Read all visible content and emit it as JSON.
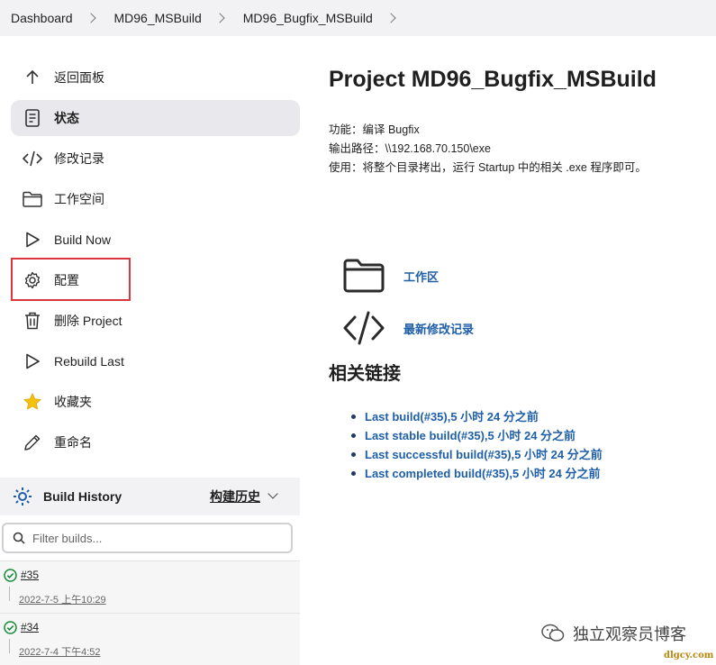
{
  "breadcrumb": [
    "Dashboard",
    "MD96_MSBuild",
    "MD96_Bugfix_MSBuild"
  ],
  "sidebar": {
    "items": [
      {
        "label": "返回面板",
        "icon": "arrow-up-icon"
      },
      {
        "label": "状态",
        "icon": "document-icon"
      },
      {
        "label": "修改记录",
        "icon": "code-icon"
      },
      {
        "label": "工作空间",
        "icon": "folder-icon"
      },
      {
        "label": "Build Now",
        "icon": "play-icon"
      },
      {
        "label": "配置",
        "icon": "gear-icon"
      },
      {
        "label": "删除 Project",
        "icon": "trash-icon"
      },
      {
        "label": "Rebuild Last",
        "icon": "play-icon"
      },
      {
        "label": "收藏夹",
        "icon": "star-icon"
      },
      {
        "label": "重命名",
        "icon": "pencil-icon"
      }
    ]
  },
  "build_history": {
    "title": "Build History",
    "trend": "构建历史",
    "filter_placeholder": "Filter builds...",
    "builds": [
      {
        "number": "#35",
        "date": "2022-7-5 上午10:29"
      },
      {
        "number": "#34",
        "date": "2022-7-4 下午4:52"
      }
    ]
  },
  "main": {
    "title": "Project MD96_Bugfix_MSBuild",
    "description": [
      "功能：编译 Bugfix",
      "输出路径：\\\\192.168.70.150\\exe",
      "使用：将整个目录拷出，运行 Startup 中的相关 .exe 程序即可。"
    ],
    "workspace_link": "工作区",
    "changes_link": "最新修改记录",
    "related_title": "相关链接",
    "related_links": [
      {
        "text": "Last build(#35),5 小时 24 分之前"
      },
      {
        "text": "Last stable build(#35),5 小时 24 分之前"
      },
      {
        "text": "Last successful build(#35),5 小时 24 分之前"
      },
      {
        "text": "Last completed build(#35),5 小时 24 分之前"
      }
    ]
  },
  "watermark": {
    "text": "独立观察员博客",
    "url": "dlgcy.com"
  },
  "colors": {
    "link": "#1e5fa8",
    "success": "#138a36",
    "highlight": "#d9363e"
  }
}
